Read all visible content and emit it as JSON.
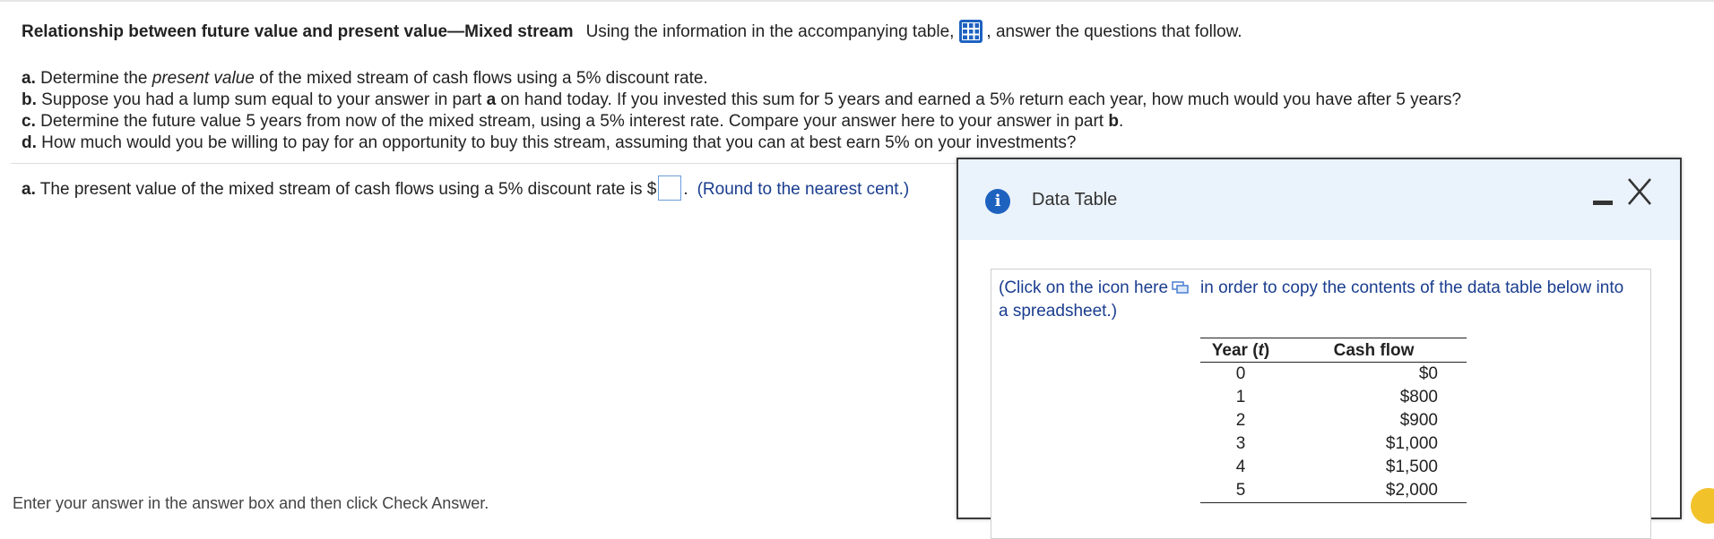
{
  "question": {
    "title": "Relationship between future value and present value—Mixed stream",
    "intro_before_icon": "Using the information in the accompanying table,",
    "intro_after_icon": ", answer the questions that follow.",
    "table_icon": "table-grid-icon"
  },
  "parts": {
    "a": {
      "label": "a.",
      "text1": " Determine the ",
      "emph": "present value",
      "text2": " of the mixed stream of cash flows using a 5% discount rate."
    },
    "b": {
      "label": "b.",
      "text1": " Suppose you had a lump sum equal to your answer in part ",
      "bold": "a",
      "text2": " on hand today. If you invested this sum for 5 years and earned a 5% return each year, how much would you have after 5 years?"
    },
    "c": {
      "label": "c.",
      "text1": " Determine the future value 5 years from now of the mixed stream, using a 5% interest rate. Compare your answer here to your answer in part ",
      "bold": "b",
      "text2": "."
    },
    "d": {
      "label": "d.",
      "text1": " How much would you be willing to pay for an opportunity to buy this stream, assuming that you can at best earn 5% on your investments?"
    }
  },
  "answer": {
    "label": "a.",
    "text": " The present value of the mixed stream of cash flows using a 5% discount rate is $",
    "after_box": ".",
    "round_note": "(Round to the nearest cent.)",
    "value": ""
  },
  "footer": {
    "text": "Enter your answer in the answer box and then click Check Answer."
  },
  "modal": {
    "title": "Data Table",
    "info_icon": "i",
    "copy_note_before": "(Click on the icon here",
    "copy_note_after": "in order to copy the contents of the data table below into a spreadsheet.)",
    "table": {
      "header_year_prefix": "Year (",
      "header_year_var": "t",
      "header_year_suffix": ")",
      "header_cash": "Cash flow",
      "rows": [
        {
          "year": "0",
          "cash": "$0"
        },
        {
          "year": "1",
          "cash": "$800"
        },
        {
          "year": "2",
          "cash": "$900"
        },
        {
          "year": "3",
          "cash": "$1,000"
        },
        {
          "year": "4",
          "cash": "$1,500"
        },
        {
          "year": "5",
          "cash": "$2,000"
        }
      ]
    }
  },
  "colors": {
    "accent_blue": "#1e62c0",
    "note_blue": "#1a3d8f",
    "modal_header": "#eaf2fb"
  }
}
